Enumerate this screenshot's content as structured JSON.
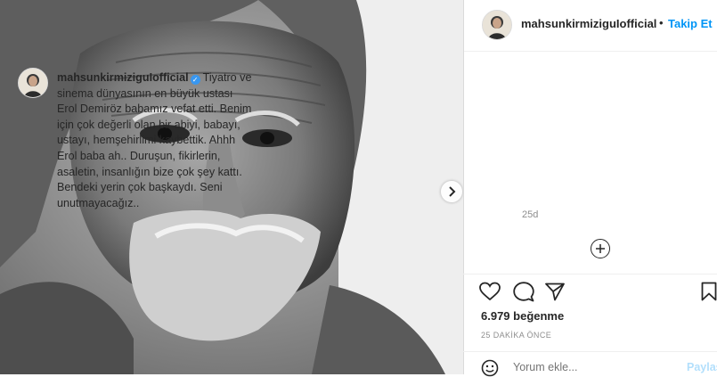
{
  "post": {
    "photo_alt": "black and white portrait photo",
    "next_icon": "chevron-right-icon"
  },
  "header": {
    "username": "mahsunkirmiziguIofficial",
    "dot": "•",
    "follow_label": "Takip Et",
    "avatar_icon": "profile-avatar"
  },
  "caption": {
    "username": "mahsunkirmiziguIofficial",
    "verified_icon": "verified-badge-icon",
    "text": "Tiyatro ve sinema dünyasının en büyük ustası Erol Demiröz babamız vefat etti. Benim için çok değerli olan bir abiyi, babayı, ustayı, hemşehirlimi kaybettik. Ahhh Erol baba ah.. Duruşun, fikirlerin, asaletin, insanlığın bize çok şey kattı. Bendeki yerin çok başkaydı. Seni unutmayacağız..",
    "age": "25d"
  },
  "actions": {
    "icons": [
      "heart-icon",
      "comment-icon",
      "share-icon",
      "bookmark-icon"
    ],
    "likes": "6.979 beğenme",
    "timestamp": "25 DAKİKA ÖNCE"
  },
  "comment": {
    "placeholder": "Yorum ekle...",
    "post_label": "Paylaş"
  },
  "colors": {
    "accent": "#0095f6",
    "text": "#262626",
    "muted": "#8e8e8e",
    "verified": "#3897f0"
  }
}
